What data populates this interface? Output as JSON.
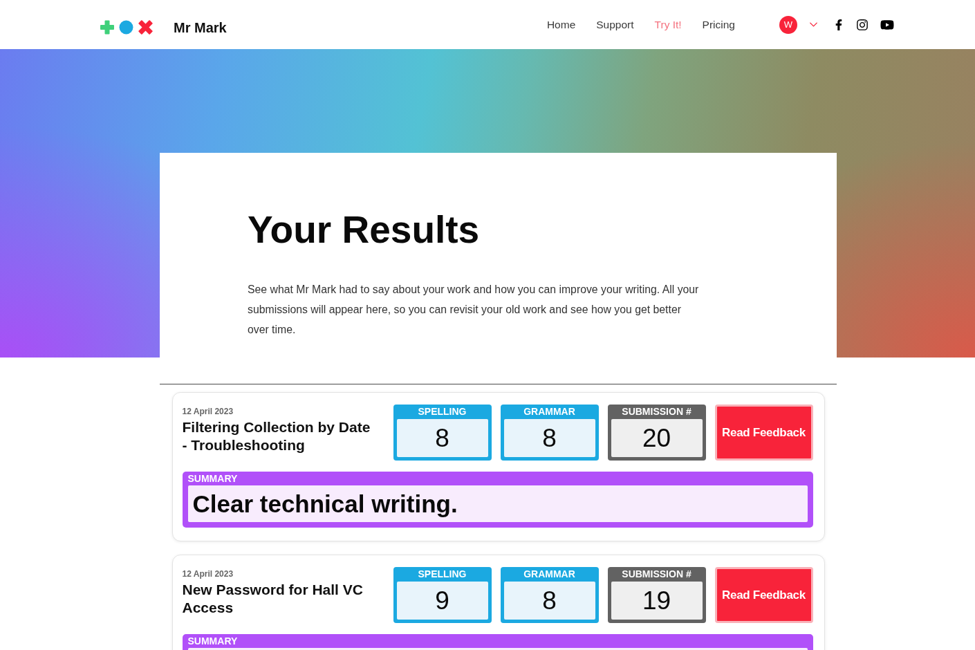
{
  "header": {
    "brand": "Mr Mark",
    "nav": [
      {
        "label": "Home",
        "kind": "link"
      },
      {
        "label": "Support",
        "kind": "link"
      },
      {
        "label": "Try It!",
        "kind": "accent"
      },
      {
        "label": "Pricing",
        "kind": "link"
      }
    ],
    "avatar": "W"
  },
  "hero": {
    "title": "Your Results",
    "description": "See what Mr Mark had to say about your work and how you can improve your writing. All your submissions will appear here, so you can revisit your old work and see how you get better over time."
  },
  "results": [
    {
      "date": "12 April 2023",
      "title": "Filtering Collection by Date - Troubleshooting",
      "scores": [
        {
          "kind": "score",
          "label": "SPELLING",
          "value": "8"
        },
        {
          "kind": "score",
          "label": "GRAMMAR",
          "value": "8"
        },
        {
          "kind": "count",
          "label": "SUBMISSION #",
          "value": "20"
        }
      ],
      "button": "Read Feedback",
      "summary_label": "SUMMARY",
      "summary": "Clear technical writing."
    },
    {
      "date": "12 April 2023",
      "title": "New Password for Hall VC Access",
      "scores": [
        {
          "kind": "score",
          "label": "SPELLING",
          "value": "9"
        },
        {
          "kind": "score",
          "label": "GRAMMAR",
          "value": "8"
        },
        {
          "kind": "count",
          "label": "SUBMISSION #",
          "value": "19"
        }
      ],
      "button": "Read Feedback",
      "summary_label": "SUMMARY"
    }
  ]
}
